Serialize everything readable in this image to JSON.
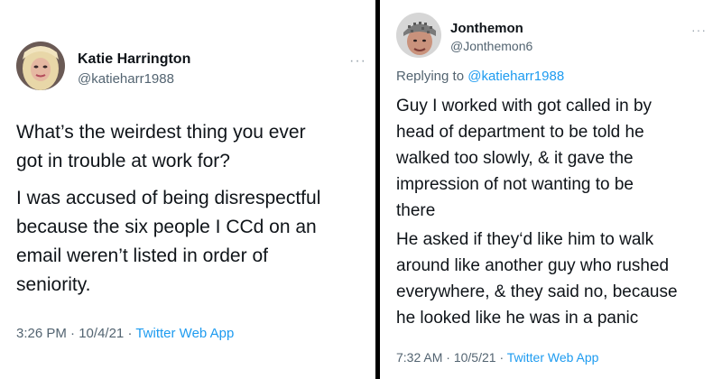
{
  "left_tweet": {
    "author_name": "Katie Harrington",
    "handle": "@katieharr1988",
    "paragraphs": [
      "What’s the weirdest thing you ever\ngot in trouble at work for?",
      "I was accused of being disrespectful\nbecause the six people I CCd on an\nemail weren’t listed in order of\nseniority."
    ],
    "time": "3:26 PM",
    "date": "10/4/21",
    "app": "Twitter Web App"
  },
  "right_tweet": {
    "author_name": "Jonthemon",
    "handle": "@Jonthemon6",
    "replying_label": "Replying to",
    "replying_handle": "@katieharr1988",
    "paragraphs": [
      "Guy I worked with got called in by\nhead of department to be told he\nwalked too slowly, & it gave the\nimpression of not wanting to be\nthere",
      "He asked if they‘d like him to walk\naround like another guy who rushed\neverywhere, & they said no, because\nhe looked like he was in a panic"
    ],
    "time": "7:32 AM",
    "date": "10/5/21",
    "app": "Twitter Web App"
  },
  "icons": {
    "more": "more-dots-icon",
    "separator": "·"
  }
}
